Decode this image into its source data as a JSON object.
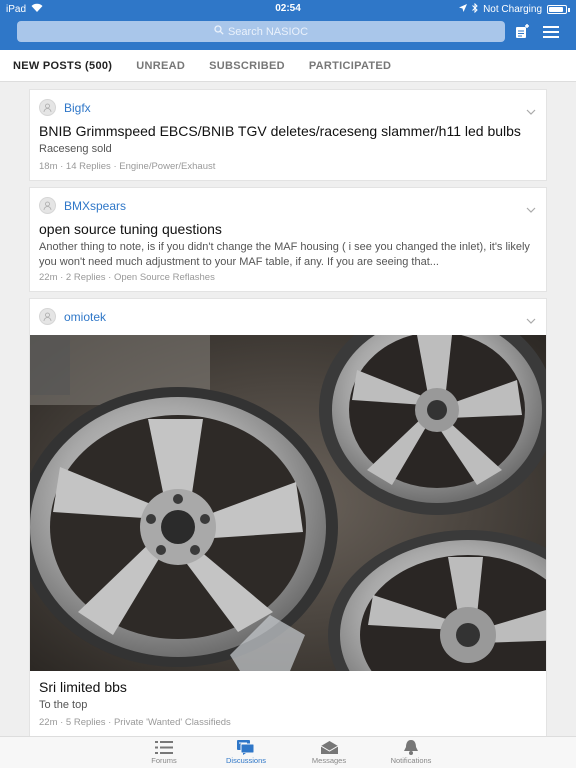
{
  "status": {
    "device": "iPad",
    "time": "02:54",
    "charging": "Not Charging"
  },
  "search": {
    "placeholder": "Search NASIOC"
  },
  "tabs": [
    {
      "label": "NEW POSTS (500)"
    },
    {
      "label": "UNREAD"
    },
    {
      "label": "SUBSCRIBED"
    },
    {
      "label": "PARTICIPATED"
    }
  ],
  "posts": [
    {
      "author": "Bigfx",
      "title": "BNIB Grimmspeed EBCS/BNIB TGV deletes/raceseng slammer/h11 led bulbs",
      "snippet": "Raceseng sold",
      "meta": "18m · 14 Replies · Engine/Power/Exhaust"
    },
    {
      "author": "BMXspears",
      "title": "open source tuning questions",
      "snippet": "Another thing to note, is if you didn't change the MAF housing ( i see you changed the inlet), it's likely you won't need much adjustment to your MAF table, if any. If you are seeing that...",
      "meta": "22m · 2 Replies · Open Source Reflashes"
    },
    {
      "author": "omiotek",
      "title": "Sri limited bbs",
      "snippet": "To the top",
      "meta": "22m · 5 Replies · Private 'Wanted' Classifieds"
    }
  ],
  "bottom_tabs": [
    {
      "label": "Forums",
      "icon": "list-icon"
    },
    {
      "label": "Discussions",
      "icon": "chat-icon"
    },
    {
      "label": "Messages",
      "icon": "envelope-icon"
    },
    {
      "label": "Notifications",
      "icon": "bell-icon"
    }
  ],
  "colors": {
    "accent": "#2f77c8",
    "background": "#efefef"
  }
}
